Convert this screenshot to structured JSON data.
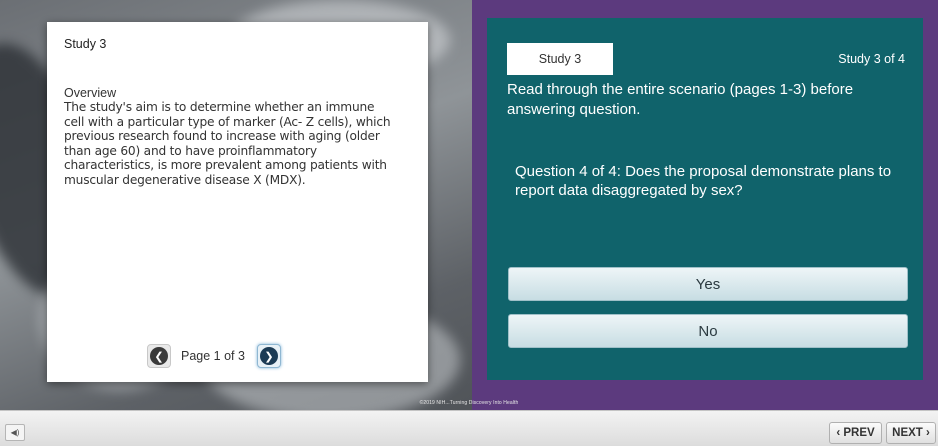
{
  "document": {
    "title": "Study 3",
    "overview_heading": "Overview",
    "overview_text": "The study's aim is to determine whether an immune cell with a particular type of marker (Ac- Z cells), which previous research found to increase with aging (older than age 60) and to have proinflammatory characteristics, is more prevalent among patients with muscular degenerative disease X (MDX).",
    "page_label": "Page 1 of 3",
    "prev_icon": "chevron-left-icon",
    "next_icon": "chevron-right-icon"
  },
  "quiz": {
    "study_tab": "Study 3",
    "study_count": "Study 3  of 4",
    "instruction": "Read through the entire scenario (pages 1-3) before answering question.",
    "question": "Question 4 of 4: Does the proposal demonstrate plans to report data disaggregated by sex?",
    "answers": [
      "Yes",
      "No"
    ]
  },
  "footer": {
    "copyright": "©2019 NIH...Turning Discovery Into Health",
    "prev_label": "‹ PREV",
    "next_label": "NEXT ›",
    "audio_icon": "speaker-icon"
  },
  "colors": {
    "quiz_frame": "#5c3a7e",
    "quiz_panel": "#10636b"
  }
}
